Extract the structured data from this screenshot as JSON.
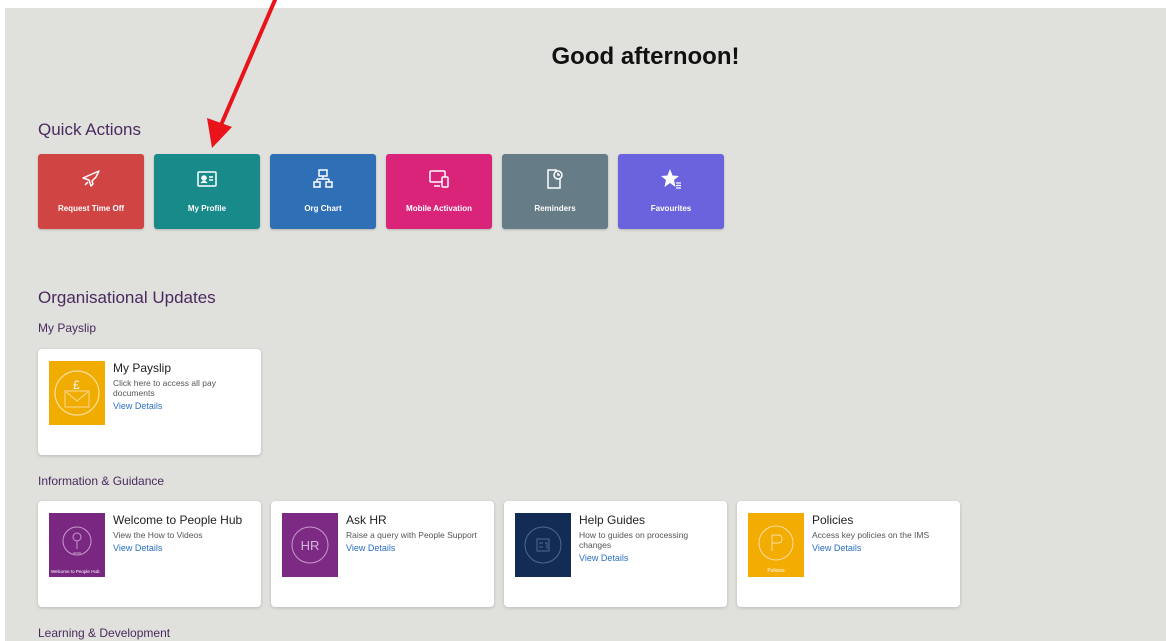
{
  "greeting": "Good afternoon!",
  "quick_actions": {
    "title": "Quick Actions",
    "tiles": [
      {
        "label": "Request Time Off",
        "icon": "airplane-icon",
        "color": "#d04444"
      },
      {
        "label": "My Profile",
        "icon": "id-card-icon",
        "color": "#198a8a"
      },
      {
        "label": "Org Chart",
        "icon": "org-chart-icon",
        "color": "#2f6fb5"
      },
      {
        "label": "Mobile Activation",
        "icon": "devices-icon",
        "color": "#d9247a"
      },
      {
        "label": "Reminders",
        "icon": "document-clock-icon",
        "color": "#667c87"
      },
      {
        "label": "Favourites",
        "icon": "star-list-icon",
        "color": "#6b62dd"
      }
    ]
  },
  "org_updates": {
    "title": "Organisational Updates",
    "groups": [
      {
        "title": "My Payslip",
        "cards": [
          {
            "title": "My Payslip",
            "subtitle": "Click here to access all pay documents",
            "link": "View Details",
            "thumb_color": "#f1ac00",
            "thumb_text": ""
          }
        ]
      },
      {
        "title": "Information & Guidance",
        "cards": [
          {
            "title": "Welcome to People Hub",
            "subtitle": "View the How to Videos",
            "link": "View Details",
            "thumb_color": "#7a2782",
            "thumb_text": "Welcome to People Hub"
          },
          {
            "title": "Ask HR",
            "subtitle": "Raise a query with People Support",
            "link": "View Details",
            "thumb_color": "#7d2a84",
            "thumb_text": "HR"
          },
          {
            "title": "Help Guides",
            "subtitle": "How to guides on processing changes",
            "link": "View Details",
            "thumb_color": "#122c55",
            "thumb_text": ""
          },
          {
            "title": "Policies",
            "subtitle": "Access key policies on the IMS",
            "link": "View Details",
            "thumb_color": "#f2ac02",
            "thumb_text": "Policies"
          }
        ]
      },
      {
        "title": "Learning & Development",
        "cards": []
      }
    ]
  },
  "colors": {
    "annotation_arrow": "#e8141a",
    "link": "#2a6fc4",
    "section_title": "#4a2a5e"
  }
}
